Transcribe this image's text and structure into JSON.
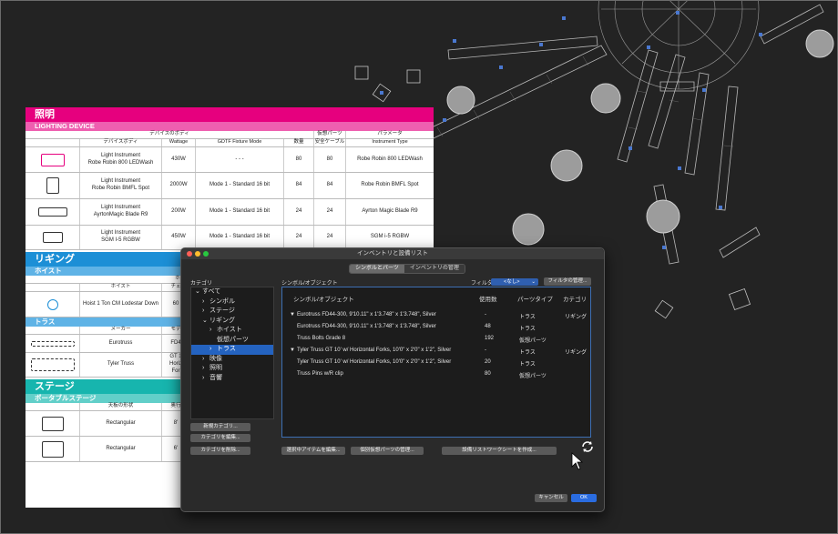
{
  "report": {
    "lighting_title": "照明",
    "lighting_sub": "LIGHTING DEVICE",
    "lighting_group_headers": [
      "デバイスのボディ",
      "仮想パーツ",
      "パラメータ"
    ],
    "lighting_headers": [
      "デバイスボディ",
      "Wattage",
      "GDTF Fixture Mode",
      "数量",
      "安全ケーブル",
      "Instrument Type"
    ],
    "lighting_rows": [
      {
        "name": "Light Instrument\nRobe Robin 800 LEDWash",
        "watt": "430W",
        "mode": "- - -",
        "qty": "80",
        "cable": "80",
        "type": "Robe Robin 800 LEDWash"
      },
      {
        "name": "Light Instrument\nRobe Robin BMFL Spot",
        "watt": "2000W",
        "mode": "Mode 1 - Standard 16 bit",
        "qty": "84",
        "cable": "84",
        "type": "Robe Robin BMFL Spot"
      },
      {
        "name": "Light Instrument\nAyrtonMagic Blade R9",
        "watt": "200W",
        "mode": "Mode 1 - Standard 16 bit",
        "qty": "24",
        "cable": "24",
        "type": "Ayrton Magic Blade R9"
      },
      {
        "name": "Light Instrument\nSGM I-5 RGBW",
        "watt": "450W",
        "mode": "Mode 1 - Standard 16 bit",
        "qty": "24",
        "cable": "24",
        "type": "SGM i-5 RGBW"
      }
    ],
    "rigging_title": "リギング",
    "hoist_sub": "ホイスト",
    "hoist_headers": [
      "ホイスト",
      "チェ"
    ],
    "hoist_row": {
      "name": "Hoist 1 Ton CM Lodestar Down",
      "value": "60"
    },
    "hoist_top_header": "ホイスト",
    "truss_sub": "トラス",
    "truss_headers": [
      "メーカー",
      "モデ"
    ],
    "truss_rows": [
      {
        "maker": "Eurotruss",
        "model": "FD4"
      },
      {
        "maker": "Tyler Truss",
        "model": "GT 1\nHoriz\nFor"
      }
    ],
    "stage_title": "ステージ",
    "stage_sub": "ポータブルステージ",
    "stage_headers": [
      "天板の形状",
      "奥行"
    ],
    "stage_rows": [
      {
        "shape": "Rectangular",
        "depth": "8'"
      },
      {
        "shape": "Rectangular",
        "depth": "6'"
      }
    ]
  },
  "dialog": {
    "title": "インベントリと設備リスト",
    "tabs": [
      "シンボルとパーツ",
      "インベントリの管理"
    ],
    "category_label": "カテゴリ",
    "symbol_label": "シンボル/オブジェクト",
    "filter_label": "フィルタ:",
    "filter_value": "<なし>",
    "filter_manage_button": "フィルタの管理...",
    "tree": [
      {
        "label": "すべて",
        "indent": 0,
        "arrow": "v"
      },
      {
        "label": "シンボル",
        "indent": 1,
        "arrow": ">"
      },
      {
        "label": "ステージ",
        "indent": 1,
        "arrow": ">"
      },
      {
        "label": "リギング",
        "indent": 1,
        "arrow": "v"
      },
      {
        "label": "ホイスト",
        "indent": 2,
        "arrow": ">"
      },
      {
        "label": "仮想パーツ",
        "indent": 2,
        "arrow": ""
      },
      {
        "label": "トラス",
        "indent": 2,
        "arrow": ">",
        "selected": true
      },
      {
        "label": "映像",
        "indent": 1,
        "arrow": ">"
      },
      {
        "label": "照明",
        "indent": 1,
        "arrow": ">"
      },
      {
        "label": "音響",
        "indent": 1,
        "arrow": ">"
      }
    ],
    "columns": [
      "シンボル/オブジェクト",
      "使用数",
      "パーツタイプ",
      "カテゴリ"
    ],
    "rows": [
      {
        "name": "Eurotruss FD44-300, 9'10.11\" x 1'3.748\" x 1'3.748\", Silver",
        "count": "-",
        "ptype": "トラス",
        "cat": "リギング",
        "arrow": "▼",
        "indent": 0
      },
      {
        "name": "Eurotruss FD44-300, 9'10.11\" x 1'3.748\" x 1'3.748\", Silver",
        "count": "48",
        "ptype": "トラス",
        "cat": "",
        "arrow": "",
        "indent": 1
      },
      {
        "name": "Truss Bolts Grade 8",
        "count": "192",
        "ptype": "仮想パーツ",
        "cat": "",
        "arrow": "",
        "indent": 1
      },
      {
        "name": "Tyler Truss GT 10' w/ Horizontal Forks, 10'0\" x 2'0\" x 1'2\", Silver",
        "count": "-",
        "ptype": "トラス",
        "cat": "リギング",
        "arrow": "▼",
        "indent": 0
      },
      {
        "name": "Tyler Truss GT 10' w/ Horizontal Forks, 10'0\" x 2'0\" x 1'2\", Silver",
        "count": "20",
        "ptype": "トラス",
        "cat": "",
        "arrow": "",
        "indent": 1
      },
      {
        "name": "Truss Pins w/R clip",
        "count": "80",
        "ptype": "仮想パーツ",
        "cat": "",
        "arrow": "",
        "indent": 1
      }
    ],
    "buttons": {
      "new_category": "新規カテゴリ...",
      "edit_category": "カテゴリを編集...",
      "delete_category": "カテゴリを削除...",
      "edit_selected": "選択中アイテムを編集...",
      "manage_parts": "個別仮想パーツの管理...",
      "create_worksheet": "設備リストワークシートを作成...",
      "cancel": "キャンセル",
      "ok": "OK"
    }
  },
  "colors": {
    "lighting": "#e6007e",
    "lighting_sub": "#ee5fb0",
    "rigging": "#1c8fd6",
    "rigging_sub": "#5fb3e6",
    "stage": "#17b5ae",
    "stage_sub": "#62cfc9",
    "selection": "#2463c0"
  }
}
